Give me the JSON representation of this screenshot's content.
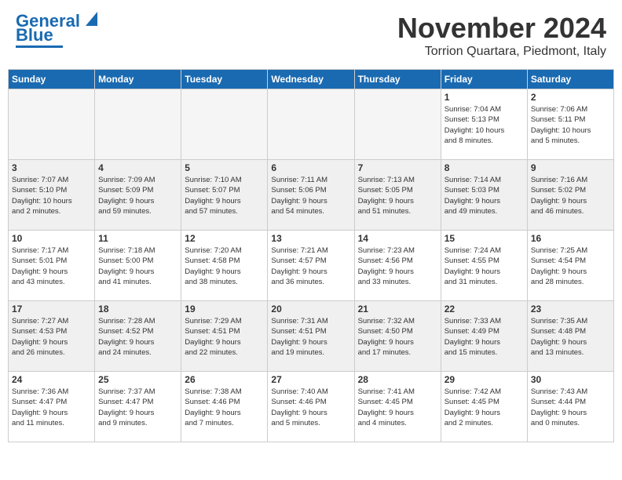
{
  "header": {
    "logo_line1": "General",
    "logo_line2": "Blue",
    "month": "November 2024",
    "location": "Torrion Quartara, Piedmont, Italy"
  },
  "weekdays": [
    "Sunday",
    "Monday",
    "Tuesday",
    "Wednesday",
    "Thursday",
    "Friday",
    "Saturday"
  ],
  "weeks": [
    {
      "alt": false,
      "days": [
        {
          "num": "",
          "info": ""
        },
        {
          "num": "",
          "info": ""
        },
        {
          "num": "",
          "info": ""
        },
        {
          "num": "",
          "info": ""
        },
        {
          "num": "",
          "info": ""
        },
        {
          "num": "1",
          "info": "Sunrise: 7:04 AM\nSunset: 5:13 PM\nDaylight: 10 hours\nand 8 minutes."
        },
        {
          "num": "2",
          "info": "Sunrise: 7:06 AM\nSunset: 5:11 PM\nDaylight: 10 hours\nand 5 minutes."
        }
      ]
    },
    {
      "alt": true,
      "days": [
        {
          "num": "3",
          "info": "Sunrise: 7:07 AM\nSunset: 5:10 PM\nDaylight: 10 hours\nand 2 minutes."
        },
        {
          "num": "4",
          "info": "Sunrise: 7:09 AM\nSunset: 5:09 PM\nDaylight: 9 hours\nand 59 minutes."
        },
        {
          "num": "5",
          "info": "Sunrise: 7:10 AM\nSunset: 5:07 PM\nDaylight: 9 hours\nand 57 minutes."
        },
        {
          "num": "6",
          "info": "Sunrise: 7:11 AM\nSunset: 5:06 PM\nDaylight: 9 hours\nand 54 minutes."
        },
        {
          "num": "7",
          "info": "Sunrise: 7:13 AM\nSunset: 5:05 PM\nDaylight: 9 hours\nand 51 minutes."
        },
        {
          "num": "8",
          "info": "Sunrise: 7:14 AM\nSunset: 5:03 PM\nDaylight: 9 hours\nand 49 minutes."
        },
        {
          "num": "9",
          "info": "Sunrise: 7:16 AM\nSunset: 5:02 PM\nDaylight: 9 hours\nand 46 minutes."
        }
      ]
    },
    {
      "alt": false,
      "days": [
        {
          "num": "10",
          "info": "Sunrise: 7:17 AM\nSunset: 5:01 PM\nDaylight: 9 hours\nand 43 minutes."
        },
        {
          "num": "11",
          "info": "Sunrise: 7:18 AM\nSunset: 5:00 PM\nDaylight: 9 hours\nand 41 minutes."
        },
        {
          "num": "12",
          "info": "Sunrise: 7:20 AM\nSunset: 4:58 PM\nDaylight: 9 hours\nand 38 minutes."
        },
        {
          "num": "13",
          "info": "Sunrise: 7:21 AM\nSunset: 4:57 PM\nDaylight: 9 hours\nand 36 minutes."
        },
        {
          "num": "14",
          "info": "Sunrise: 7:23 AM\nSunset: 4:56 PM\nDaylight: 9 hours\nand 33 minutes."
        },
        {
          "num": "15",
          "info": "Sunrise: 7:24 AM\nSunset: 4:55 PM\nDaylight: 9 hours\nand 31 minutes."
        },
        {
          "num": "16",
          "info": "Sunrise: 7:25 AM\nSunset: 4:54 PM\nDaylight: 9 hours\nand 28 minutes."
        }
      ]
    },
    {
      "alt": true,
      "days": [
        {
          "num": "17",
          "info": "Sunrise: 7:27 AM\nSunset: 4:53 PM\nDaylight: 9 hours\nand 26 minutes."
        },
        {
          "num": "18",
          "info": "Sunrise: 7:28 AM\nSunset: 4:52 PM\nDaylight: 9 hours\nand 24 minutes."
        },
        {
          "num": "19",
          "info": "Sunrise: 7:29 AM\nSunset: 4:51 PM\nDaylight: 9 hours\nand 22 minutes."
        },
        {
          "num": "20",
          "info": "Sunrise: 7:31 AM\nSunset: 4:51 PM\nDaylight: 9 hours\nand 19 minutes."
        },
        {
          "num": "21",
          "info": "Sunrise: 7:32 AM\nSunset: 4:50 PM\nDaylight: 9 hours\nand 17 minutes."
        },
        {
          "num": "22",
          "info": "Sunrise: 7:33 AM\nSunset: 4:49 PM\nDaylight: 9 hours\nand 15 minutes."
        },
        {
          "num": "23",
          "info": "Sunrise: 7:35 AM\nSunset: 4:48 PM\nDaylight: 9 hours\nand 13 minutes."
        }
      ]
    },
    {
      "alt": false,
      "days": [
        {
          "num": "24",
          "info": "Sunrise: 7:36 AM\nSunset: 4:47 PM\nDaylight: 9 hours\nand 11 minutes."
        },
        {
          "num": "25",
          "info": "Sunrise: 7:37 AM\nSunset: 4:47 PM\nDaylight: 9 hours\nand 9 minutes."
        },
        {
          "num": "26",
          "info": "Sunrise: 7:38 AM\nSunset: 4:46 PM\nDaylight: 9 hours\nand 7 minutes."
        },
        {
          "num": "27",
          "info": "Sunrise: 7:40 AM\nSunset: 4:46 PM\nDaylight: 9 hours\nand 5 minutes."
        },
        {
          "num": "28",
          "info": "Sunrise: 7:41 AM\nSunset: 4:45 PM\nDaylight: 9 hours\nand 4 minutes."
        },
        {
          "num": "29",
          "info": "Sunrise: 7:42 AM\nSunset: 4:45 PM\nDaylight: 9 hours\nand 2 minutes."
        },
        {
          "num": "30",
          "info": "Sunrise: 7:43 AM\nSunset: 4:44 PM\nDaylight: 9 hours\nand 0 minutes."
        }
      ]
    }
  ]
}
